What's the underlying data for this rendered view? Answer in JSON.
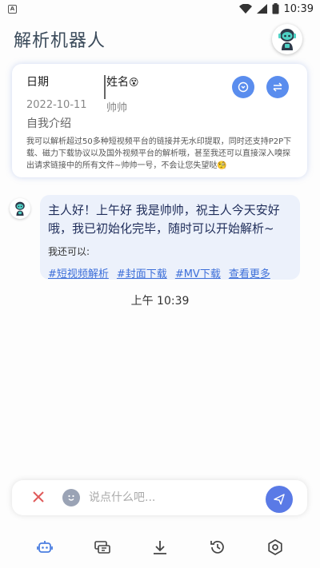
{
  "status_bar": {
    "time": "10:39",
    "app_icon_letter": "A",
    "icons": [
      "wifi-icon",
      "signal-icon",
      "battery-icon"
    ]
  },
  "app_bar": {
    "title": "解析机器人",
    "avatar_icon": "robot-icon"
  },
  "profile_card": {
    "date_label": "日期",
    "date_value": "2022-10-11",
    "name_label": "姓名",
    "name_emoji": "😵",
    "name_value": "帅帅",
    "intro_title": "自我介绍",
    "intro_text": "我可以解析超过50多种短视频平台的链接并无水印提取，同时还支持P2P下载、磁力下载协议以及国外视频平台的解析哦，甚至我还可以直接深入嗅探出请求链接中的所有文件~帅帅一号，不会让您失望哒🧐",
    "buttons": [
      "refresh-icon",
      "swap-icon"
    ]
  },
  "chat": {
    "message": "主人好！上午好 我是帅帅，祝主人今天安好哦，我已初始化完毕，随时可以开始解析~",
    "sub_label": "我还可以:",
    "links": [
      "#短视频解析",
      "#封面下载",
      "#MV下载",
      "查看更多"
    ],
    "timestamp": "上午 10:39"
  },
  "input_bar": {
    "placeholder": "说点什么吧..."
  },
  "tab_bar": {
    "tabs": [
      "robot-icon",
      "media-icon",
      "download-icon",
      "history-icon",
      "settings-icon"
    ],
    "active_color": "#4a7de0"
  },
  "colors": {
    "accent": "#5a8dee",
    "bubble": "#ecf1fb",
    "link": "#3d6fd9"
  }
}
